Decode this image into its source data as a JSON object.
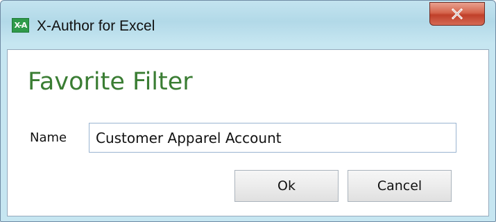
{
  "window": {
    "app_icon_text": "X-A",
    "title": "X-Author for Excel",
    "close_icon": "close-icon"
  },
  "dialog": {
    "heading": "Favorite Filter",
    "name_label": "Name",
    "name_value": "Customer Apparel Account",
    "ok_label": "Ok",
    "cancel_label": "Cancel"
  },
  "colors": {
    "heading": "#3a7d33",
    "app_icon_bg": "#2f9a4a",
    "title_bar": "#b2d9e8",
    "close_button": "#c0402a"
  }
}
